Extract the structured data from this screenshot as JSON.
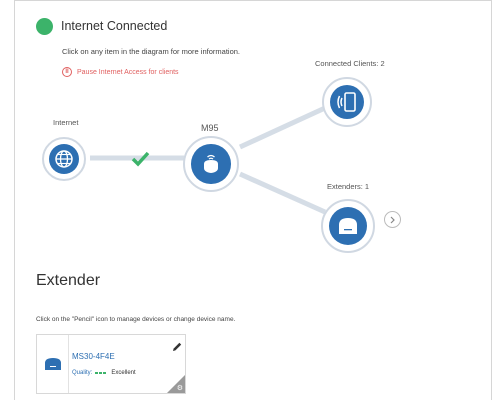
{
  "status": {
    "text": "Internet Connected",
    "color": "#3cb36a"
  },
  "hint": "Click on any item in the diagram for more information.",
  "pause_link": {
    "icon": "pause-icon",
    "label": "Pause Internet Access for clients"
  },
  "diagram": {
    "internet_label": "Internet",
    "router_label": "M95",
    "clients_label": "Connected Clients: 2",
    "extenders_label": "Extenders: 1",
    "link_status_icon": "checkmark-icon",
    "next_icon": "chevron-right-icon",
    "accent": "#2d6fb2"
  },
  "extender_section": {
    "title": "Extender",
    "manage_hint": "Click on the \"Pencil\" icon to manage devices or change device name.",
    "card": {
      "name": "MS30-4F4E",
      "quality_label": "Quality:",
      "quality_value": "Excellent",
      "edit_icon": "pencil-icon",
      "settings_icon": "gear-icon"
    }
  }
}
